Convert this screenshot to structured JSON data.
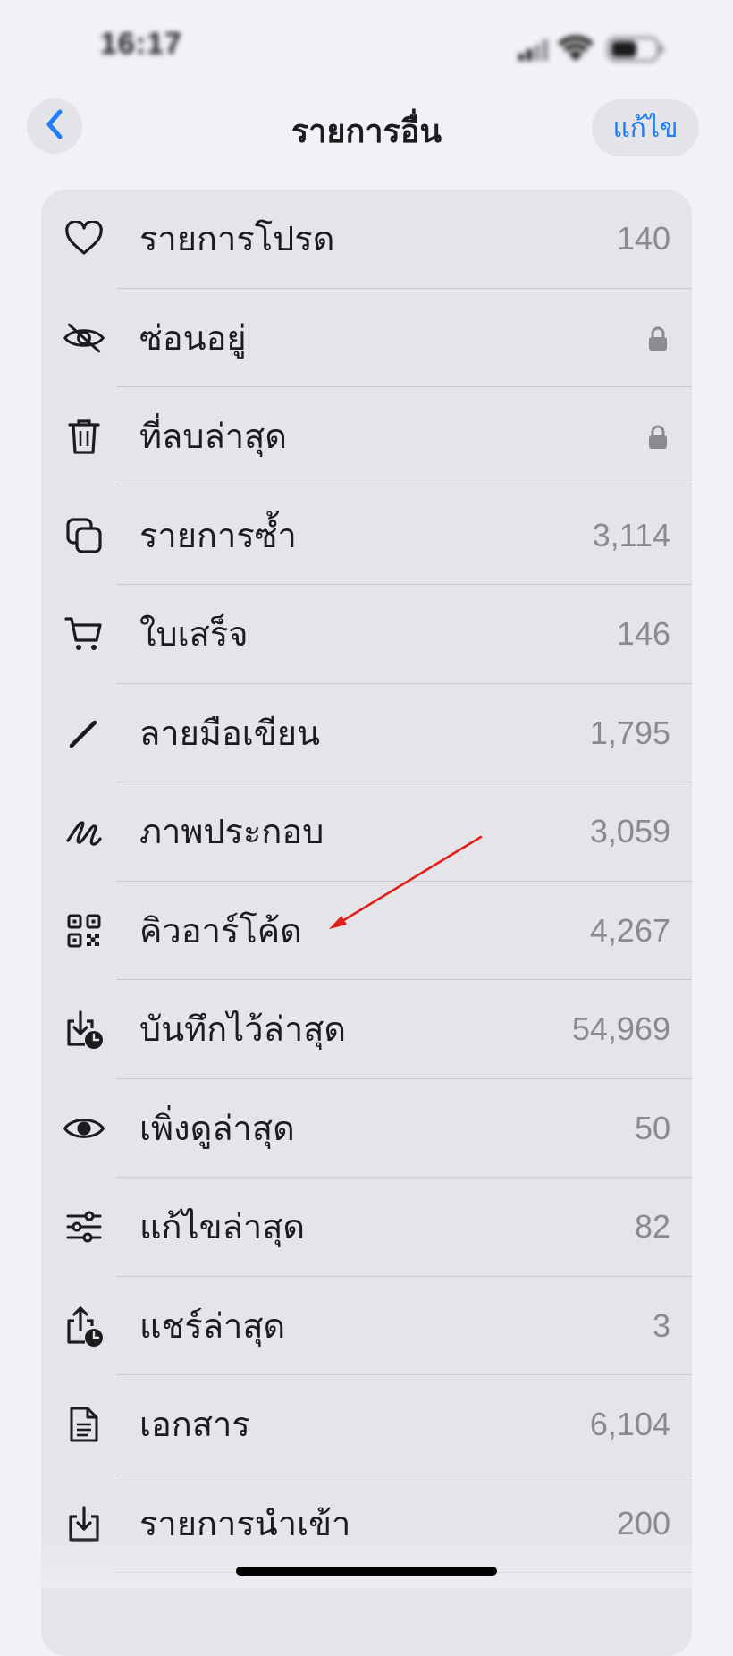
{
  "status_bar": {
    "time": "16:17",
    "icons": [
      "signal-icon",
      "wifi-icon",
      "battery-icon"
    ]
  },
  "nav": {
    "back_icon": "chevron-left-icon",
    "title": "รายการอื่น",
    "edit_label": "แก้ไข"
  },
  "colors": {
    "accent": "#1e7df6",
    "background": "#f2f2f6",
    "card": "#e4e4e9",
    "secondary_text": "#8a8a8f",
    "annotation_arrow": "#e0201a"
  },
  "items": [
    {
      "icon": "heart-icon",
      "label": "รายการโปรด",
      "value": "140"
    },
    {
      "icon": "eye-slash-icon",
      "label": "ซ่อนอยู่",
      "value": "",
      "locked": true
    },
    {
      "icon": "trash-icon",
      "label": "ที่ลบล่าสุด",
      "value": "",
      "locked": true
    },
    {
      "icon": "duplicate-icon",
      "label": "รายการซ้ำ",
      "value": "3,114"
    },
    {
      "icon": "cart-icon",
      "label": "ใบเสร็จ",
      "value": "146"
    },
    {
      "icon": "pencil-icon",
      "label": "ลายมือเขียน",
      "value": "1,795"
    },
    {
      "icon": "scribble-icon",
      "label": "ภาพประกอบ",
      "value": "3,059"
    },
    {
      "icon": "qr-code-icon",
      "label": "คิวอาร์โค้ด",
      "value": "4,267"
    },
    {
      "icon": "download-clock-icon",
      "label": "บันทึกไว้ล่าสุด",
      "value": "54,969"
    },
    {
      "icon": "eye-icon",
      "label": "เพิ่งดูล่าสุด",
      "value": "50"
    },
    {
      "icon": "sliders-icon",
      "label": "แก้ไขล่าสุด",
      "value": "82"
    },
    {
      "icon": "share-clock-icon",
      "label": "แชร์ล่าสุด",
      "value": "3"
    },
    {
      "icon": "document-icon",
      "label": "เอกสาร",
      "value": "6,104"
    },
    {
      "icon": "import-icon",
      "label": "รายการนำเข้า",
      "value": "200"
    }
  ],
  "annotation": {
    "type": "red-arrow",
    "points_to": "คิวอาร์โค้ด"
  }
}
